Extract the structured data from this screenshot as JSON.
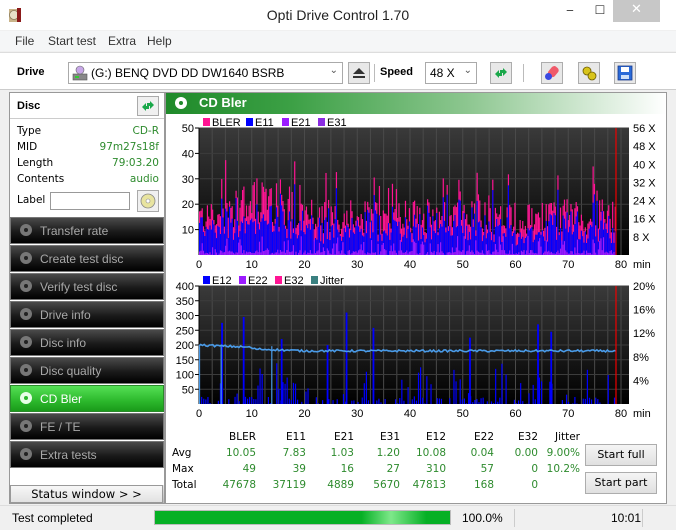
{
  "window": {
    "title": "Opti Drive Control 1.70",
    "minimize": "‒",
    "maximize": "☐",
    "close": "✕"
  },
  "menu": [
    "File",
    "Start test",
    "Extra",
    "Help"
  ],
  "toolbar": {
    "drive_label": "Drive",
    "drive_value": "(G:)  BENQ DVD DD DW1640 BSRB",
    "speed_label": "Speed",
    "speed_value": "48 X",
    "icons": [
      "eject-icon",
      "refresh-icon",
      "erase-icon",
      "settings-icon",
      "save-icon"
    ]
  },
  "disc": {
    "header": "Disc",
    "fields": [
      {
        "key": "Type",
        "value": "CD-R"
      },
      {
        "key": "MID",
        "value": "97m27s18f"
      },
      {
        "key": "Length",
        "value": "79:03.20"
      },
      {
        "key": "Contents",
        "value": "audio"
      }
    ],
    "label_key": "Label",
    "label_value": ""
  },
  "nav": [
    {
      "label": "Transfer rate",
      "active": false
    },
    {
      "label": "Create test disc",
      "active": false
    },
    {
      "label": "Verify test disc",
      "active": false
    },
    {
      "label": "Drive info",
      "active": false
    },
    {
      "label": "Disc info",
      "active": false
    },
    {
      "label": "Disc quality",
      "active": false
    },
    {
      "label": "CD Bler",
      "active": true
    },
    {
      "label": "FE / TE",
      "active": false
    },
    {
      "label": "Extra tests",
      "active": false
    }
  ],
  "status_window_label": "Status window > >",
  "panel": {
    "title": "CD Bler"
  },
  "chart_data": [
    {
      "type": "bar",
      "title": "CD Bler (upper)",
      "legend": [
        {
          "name": "BLER",
          "color": "#ff1493"
        },
        {
          "name": "E11",
          "color": "#0000ff"
        },
        {
          "name": "E21",
          "color": "#9b1bff"
        },
        {
          "name": "E31",
          "color": "#8a2be2"
        }
      ],
      "x_ticks": [
        "0",
        "10",
        "20",
        "30",
        "40",
        "50",
        "60",
        "70",
        "80"
      ],
      "x_unit": "min",
      "xlim": [
        0,
        80
      ],
      "y_ticks": [
        "10",
        "20",
        "30",
        "40",
        "50"
      ],
      "ylim": [
        0,
        50
      ],
      "y2_ticks": [
        "8 X",
        "16 X",
        "24 X",
        "32 X",
        "40 X",
        "48 X",
        "56 X"
      ],
      "y2lim": [
        0,
        56
      ],
      "end_marker_min": 79.05,
      "series_summary": {
        "BLER": {
          "avg": 10.05,
          "max": 49
        },
        "E11": {
          "avg": 7.83,
          "max": 39
        },
        "E21": {
          "avg": 1.03,
          "max": 16
        },
        "E31": {
          "avg": 1.2,
          "max": 27
        }
      }
    },
    {
      "type": "bar",
      "title": "CD Bler (lower)",
      "legend": [
        {
          "name": "E12",
          "color": "#0000ff"
        },
        {
          "name": "E22",
          "color": "#9b1bff"
        },
        {
          "name": "E32",
          "color": "#ff1493"
        },
        {
          "name": "Jitter",
          "color": "#3a8080"
        }
      ],
      "x_ticks": [
        "0",
        "10",
        "20",
        "30",
        "40",
        "50",
        "60",
        "70",
        "80"
      ],
      "x_unit": "min",
      "xlim": [
        0,
        80
      ],
      "y_ticks": [
        "50",
        "100",
        "150",
        "200",
        "250",
        "300",
        "350",
        "400"
      ],
      "ylim": [
        0,
        400
      ],
      "y2_ticks": [
        "4%",
        "8%",
        "12%",
        "16%",
        "20%"
      ],
      "y2lim": [
        0,
        20
      ],
      "jitter_line_color": "#4a9be8",
      "jitter_approx_percent": {
        "start": 10.0,
        "end": 9.0
      },
      "e12_spikes": [
        {
          "x": 4.2,
          "y": 275
        },
        {
          "x": 8.3,
          "y": 295
        },
        {
          "x": 15.5,
          "y": 220
        },
        {
          "x": 24.2,
          "y": 200
        },
        {
          "x": 27.8,
          "y": 310
        },
        {
          "x": 32.9,
          "y": 258
        },
        {
          "x": 51.2,
          "y": 225
        },
        {
          "x": 64.1,
          "y": 270
        },
        {
          "x": 66.6,
          "y": 245
        }
      ],
      "end_marker_min": 79.05
    }
  ],
  "stats": {
    "columns": [
      "BLER",
      "E11",
      "E21",
      "E31",
      "E12",
      "E22",
      "E32",
      "Jitter"
    ],
    "rows": [
      {
        "label": "Avg",
        "values": [
          "10.05",
          "7.83",
          "1.03",
          "1.20",
          "10.08",
          "0.04",
          "0.00",
          "9.00%"
        ]
      },
      {
        "label": "Max",
        "values": [
          "49",
          "39",
          "16",
          "27",
          "310",
          "57",
          "0",
          "10.2%"
        ]
      },
      {
        "label": "Total",
        "values": [
          "47678",
          "37119",
          "4889",
          "5670",
          "47813",
          "168",
          "0",
          ""
        ]
      }
    ],
    "start_full": "Start full",
    "start_part": "Start part"
  },
  "statusbar": {
    "message": "Test completed",
    "progress": 100.0,
    "progress_text": "100.0%",
    "time": "10:01"
  }
}
